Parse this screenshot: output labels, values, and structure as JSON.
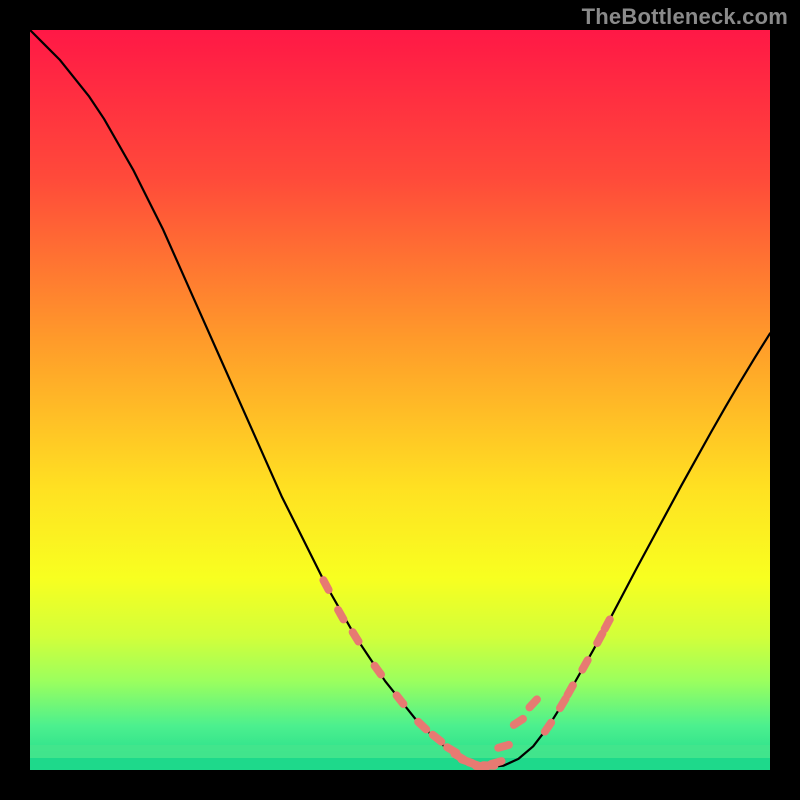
{
  "watermark": {
    "text": "TheBottleneck.com"
  },
  "colors": {
    "black": "#000000",
    "curve": "#000000",
    "marker": "#e77a72",
    "gradient_stops": [
      {
        "offset": 0.0,
        "color": "#ff1846"
      },
      {
        "offset": 0.2,
        "color": "#ff4a3a"
      },
      {
        "offset": 0.42,
        "color": "#ff9b2a"
      },
      {
        "offset": 0.62,
        "color": "#ffe122"
      },
      {
        "offset": 0.74,
        "color": "#f8ff20"
      },
      {
        "offset": 0.82,
        "color": "#d2ff3a"
      },
      {
        "offset": 0.88,
        "color": "#9bff5e"
      },
      {
        "offset": 0.94,
        "color": "#4cf08e"
      },
      {
        "offset": 1.0,
        "color": "#1ed98b"
      }
    ],
    "green_band": "#27e08e"
  },
  "chart_data": {
    "type": "line",
    "title": "",
    "xlabel": "",
    "ylabel": "",
    "xlim": [
      0,
      100
    ],
    "ylim": [
      0,
      100
    ],
    "x": [
      0,
      2,
      4,
      6,
      8,
      10,
      12,
      14,
      16,
      18,
      20,
      22,
      24,
      26,
      28,
      30,
      32,
      34,
      36,
      38,
      40,
      42,
      44,
      46,
      48,
      50,
      52,
      54,
      56,
      58,
      60,
      62,
      64,
      66,
      68,
      70,
      72,
      74,
      76,
      78,
      80,
      82,
      84,
      86,
      88,
      90,
      92,
      94,
      96,
      98,
      100
    ],
    "series": [
      {
        "name": "bottleneck-curve",
        "values": [
          100,
          98,
          96,
          93.5,
          91,
          88,
          84.5,
          81,
          77,
          73,
          68.5,
          64,
          59.5,
          55,
          50.5,
          46,
          41.5,
          37,
          33,
          29,
          25,
          21.5,
          18,
          15,
          12,
          9.5,
          7,
          5,
          3.2,
          1.8,
          0.8,
          0.4,
          0.6,
          1.5,
          3.2,
          5.8,
          9,
          12.5,
          16,
          19.7,
          23.5,
          27.3,
          31,
          34.7,
          38.4,
          42,
          45.6,
          49.1,
          52.5,
          55.8,
          59
        ]
      }
    ],
    "markers": {
      "name": "highlighted-points",
      "color": "#e77a72",
      "x": [
        40,
        42,
        44,
        47,
        50,
        53,
        55,
        57,
        58,
        59,
        60,
        61,
        62,
        63,
        64,
        66,
        68,
        70,
        72,
        73,
        75,
        77,
        78
      ],
      "values": [
        25,
        21,
        18,
        13.5,
        9.5,
        6,
        4.3,
        2.7,
        1.8,
        1.2,
        0.8,
        0.5,
        0.6,
        1.0,
        3.2,
        6.5,
        9.0,
        5.8,
        9.0,
        10.8,
        14.2,
        17.8,
        19.7
      ]
    }
  }
}
